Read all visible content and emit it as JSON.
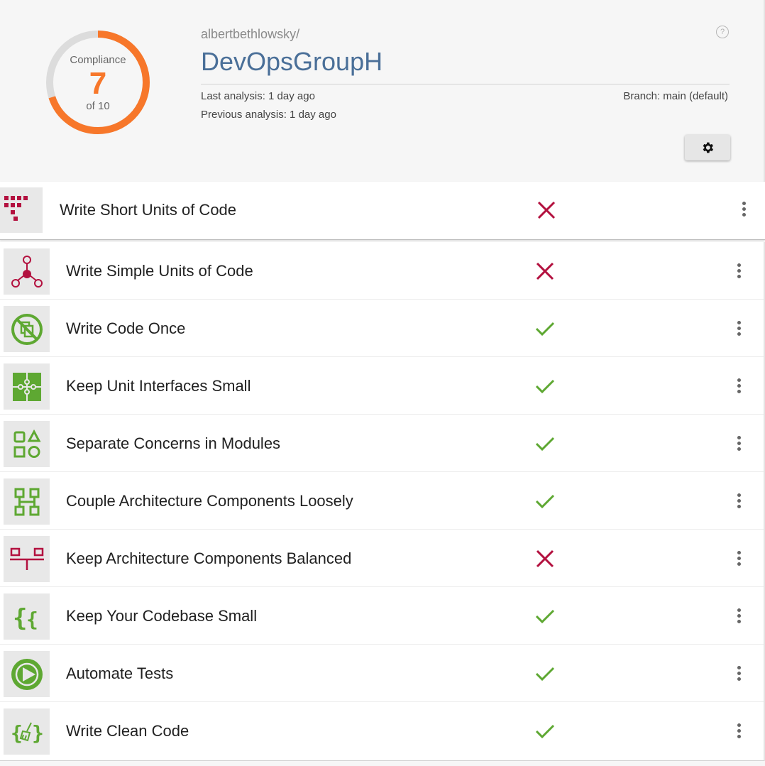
{
  "colors": {
    "accent_orange": "#f7772a",
    "title_blue": "#4a6f98",
    "fail_red": "#b3113f",
    "pass_green": "#5ea832"
  },
  "summary": {
    "label": "Compliance",
    "score": "7",
    "total": "of 10",
    "compliance_fraction": 0.7
  },
  "repo": {
    "owner": "albertbethlowsky/",
    "name": "DevOpsGroupH",
    "last_analysis": "Last analysis: 1 day ago",
    "previous_analysis": "Previous analysis: 1 day ago",
    "branch": "Branch: main (default)"
  },
  "help_icon": "help-circle-icon",
  "settings_icon": "gear-icon",
  "guidelines": [
    {
      "label": "Write Short Units of Code",
      "status": "fail",
      "icon": "short-units-icon"
    },
    {
      "label": "Write Simple Units of Code",
      "status": "fail",
      "icon": "simple-units-icon"
    },
    {
      "label": "Write Code Once",
      "status": "pass",
      "icon": "code-once-icon"
    },
    {
      "label": "Keep Unit Interfaces Small",
      "status": "pass",
      "icon": "puzzle-icon"
    },
    {
      "label": "Separate Concerns in Modules",
      "status": "pass",
      "icon": "modules-icon"
    },
    {
      "label": "Couple Architecture Components Loosely",
      "status": "pass",
      "icon": "loose-coupling-icon"
    },
    {
      "label": "Keep Architecture Components Balanced",
      "status": "fail",
      "icon": "balance-icon"
    },
    {
      "label": "Keep Your Codebase Small",
      "status": "pass",
      "icon": "braces-icon"
    },
    {
      "label": "Automate Tests",
      "status": "pass",
      "icon": "play-icon"
    },
    {
      "label": "Write Clean Code",
      "status": "pass",
      "icon": "broom-braces-icon"
    }
  ]
}
